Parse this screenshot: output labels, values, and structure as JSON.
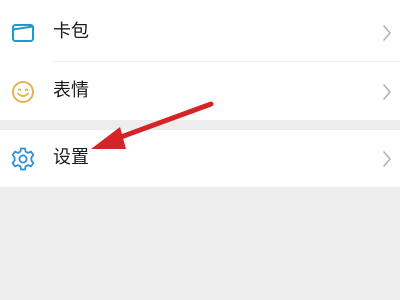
{
  "menu": {
    "items": [
      {
        "label": "卡包",
        "icon": "card-wallet-icon",
        "icon_color": "#1a9ad6"
      },
      {
        "label": "表情",
        "icon": "emoji-smile-icon",
        "icon_color": "#e5b354"
      },
      {
        "label": "设置",
        "icon": "gear-icon",
        "icon_color": "#2f8fd8"
      }
    ]
  },
  "colors": {
    "background": "#ededed",
    "row": "#ffffff",
    "text": "#1b1b1b",
    "chevron": "#b2b2b2",
    "annotation_arrow": "#d42427"
  }
}
